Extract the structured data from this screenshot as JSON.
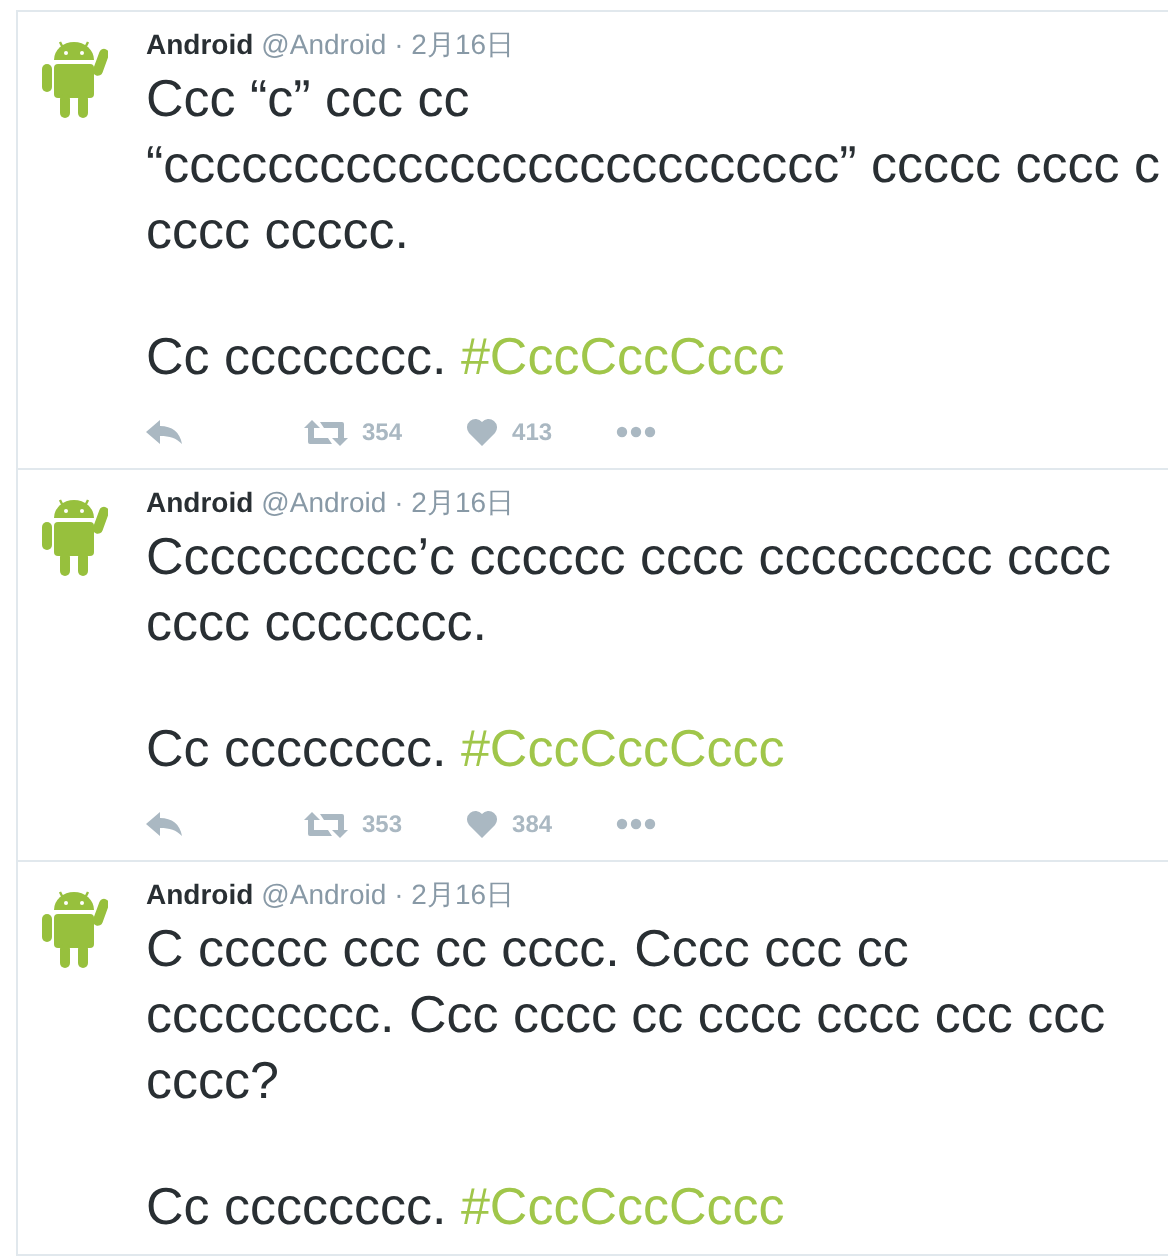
{
  "tweets": [
    {
      "name": "Android",
      "handle": "@Android",
      "date": "· 2月16日",
      "paragraphs": [
        "Ccc “c” ccc cc “cccccccccccccccccccccccccc” ccccc cccc c cccc ccccc."
      ],
      "closing": "Cc cccccccc.",
      "hashtag": "#CccCccCccc",
      "actions": {
        "retweets": "354",
        "likes": "413"
      }
    },
    {
      "name": "Android",
      "handle": "@Android",
      "date": "· 2月16日",
      "paragraphs": [
        "Cccccccccc’c cccccc cccc ccccccccc cccc cccc cccccccc."
      ],
      "closing": "Cc cccccccc.",
      "hashtag": "#CccCccCccc",
      "actions": {
        "retweets": "353",
        "likes": "384"
      }
    },
    {
      "name": "Android",
      "handle": "@Android",
      "date": "· 2月16日",
      "paragraphs": [
        "C ccccc ccc cc cccc. Cccc ccc cc ccccccccc. Ccc cccc cc cccc cccc ccc ccc cccc?"
      ],
      "closing": "Cc cccccccc.",
      "hashtag": "#CccCccCccc"
    }
  ]
}
